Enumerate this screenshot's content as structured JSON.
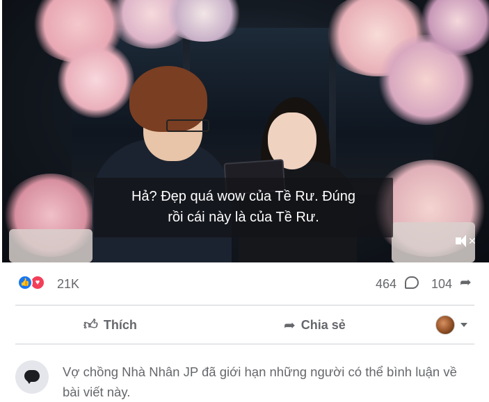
{
  "video": {
    "caption_line1": "Hả? Đẹp quá wow của Tề Rư. Đúng",
    "caption_line2": "rồi cái này là của Tề Rư.",
    "mute_icon": "speaker-muted-icon"
  },
  "reactions": {
    "icons": [
      "like-icon",
      "love-icon"
    ],
    "count": "21K",
    "comments": "464",
    "shares": "104",
    "colors": {
      "like": "#1877f2",
      "love": "#f33e58"
    }
  },
  "actions": {
    "like_label": "Thích",
    "share_label": "Chia sẻ"
  },
  "notice": {
    "text": "Vợ chồng Nhà Nhân JP đã giới hạn những người có thể bình luận về bài viết này."
  }
}
